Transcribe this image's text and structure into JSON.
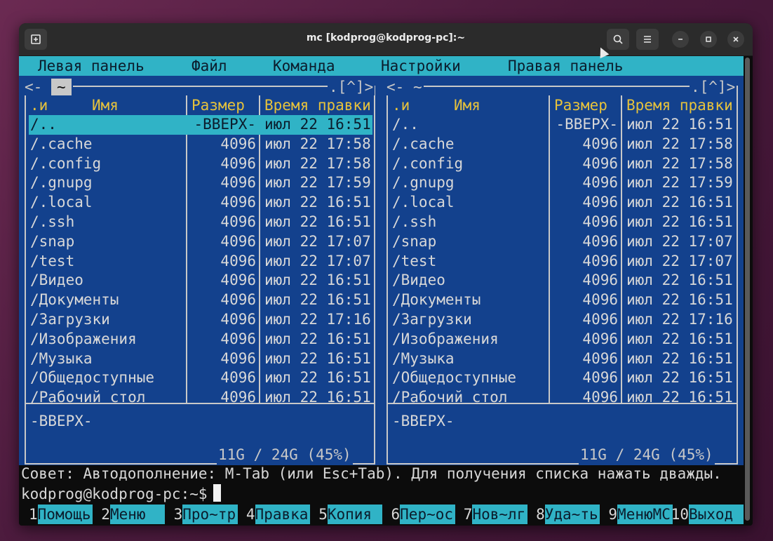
{
  "window": {
    "title": "mc [kodprog@kodprog-pc]:~"
  },
  "menubar": {
    "items": [
      "Левая панель",
      "Файл",
      "Команда",
      "Настройки",
      "Правая панель"
    ]
  },
  "left_panel": {
    "path": "~",
    "top_right": ".[^]>",
    "top_left": "<-",
    "headers": {
      "n": ".и",
      "name": "Имя",
      "size": "Размер",
      "mtime": "Время правки"
    },
    "rows": [
      {
        "name": "/..",
        "size": "-ВВЕРХ-",
        "mtime": "июл 22 16:51"
      },
      {
        "name": "/.cache",
        "size": "4096",
        "mtime": "июл 22 17:58"
      },
      {
        "name": "/.config",
        "size": "4096",
        "mtime": "июл 22 17:58"
      },
      {
        "name": "/.gnupg",
        "size": "4096",
        "mtime": "июл 22 17:59"
      },
      {
        "name": "/.local",
        "size": "4096",
        "mtime": "июл 22 16:51"
      },
      {
        "name": "/.ssh",
        "size": "4096",
        "mtime": "июл 22 16:51"
      },
      {
        "name": "/snap",
        "size": "4096",
        "mtime": "июл 22 17:07"
      },
      {
        "name": "/test",
        "size": "4096",
        "mtime": "июл 22 17:07"
      },
      {
        "name": "/Видео",
        "size": "4096",
        "mtime": "июл 22 16:51"
      },
      {
        "name": "/Документы",
        "size": "4096",
        "mtime": "июл 22 16:51"
      },
      {
        "name": "/Загрузки",
        "size": "4096",
        "mtime": "июл 22 17:16"
      },
      {
        "name": "/Изображения",
        "size": "4096",
        "mtime": "июл 22 16:51"
      },
      {
        "name": "/Музыка",
        "size": "4096",
        "mtime": "июл 22 16:51"
      },
      {
        "name": "/Общедоступные",
        "size": "4096",
        "mtime": "июл 22 16:51"
      },
      {
        "name": "/Рабочий стол",
        "size": "4096",
        "mtime": "июл 22 16:51"
      }
    ],
    "status": "-ВВЕРХ-",
    "disk": "11G / 24G (45%)"
  },
  "right_panel": {
    "path": "~",
    "top_right": ".[^]>",
    "top_left": "<-",
    "headers": {
      "n": ".и",
      "name": "Имя",
      "size": "Размер",
      "mtime": "Время правки"
    },
    "rows": [
      {
        "name": "/..",
        "size": "-ВВЕРХ-",
        "mtime": "июл 22 16:51"
      },
      {
        "name": "/.cache",
        "size": "4096",
        "mtime": "июл 22 17:58"
      },
      {
        "name": "/.config",
        "size": "4096",
        "mtime": "июл 22 17:58"
      },
      {
        "name": "/.gnupg",
        "size": "4096",
        "mtime": "июл 22 17:59"
      },
      {
        "name": "/.local",
        "size": "4096",
        "mtime": "июл 22 16:51"
      },
      {
        "name": "/.ssh",
        "size": "4096",
        "mtime": "июл 22 16:51"
      },
      {
        "name": "/snap",
        "size": "4096",
        "mtime": "июл 22 17:07"
      },
      {
        "name": "/test",
        "size": "4096",
        "mtime": "июл 22 17:07"
      },
      {
        "name": "/Видео",
        "size": "4096",
        "mtime": "июл 22 16:51"
      },
      {
        "name": "/Документы",
        "size": "4096",
        "mtime": "июл 22 16:51"
      },
      {
        "name": "/Загрузки",
        "size": "4096",
        "mtime": "июл 22 17:16"
      },
      {
        "name": "/Изображения",
        "size": "4096",
        "mtime": "июл 22 16:51"
      },
      {
        "name": "/Музыка",
        "size": "4096",
        "mtime": "июл 22 16:51"
      },
      {
        "name": "/Общедоступные",
        "size": "4096",
        "mtime": "июл 22 16:51"
      },
      {
        "name": "/Рабочий стол",
        "size": "4096",
        "mtime": "июл 22 16:51"
      }
    ],
    "status": "-ВВЕРХ-",
    "disk": "11G / 24G (45%)"
  },
  "hint": "Совет: Автодополнение: M-Tab (или Esc+Tab). Для получения списка нажать дважды.",
  "prompt": "kodprog@kodprog-pc:~$",
  "fkeys": [
    {
      "num": "1",
      "label": "Помощь"
    },
    {
      "num": "2",
      "label": "Меню  "
    },
    {
      "num": "3",
      "label": "Про~тр"
    },
    {
      "num": "4",
      "label": "Правка"
    },
    {
      "num": "5",
      "label": "Копия "
    },
    {
      "num": "6",
      "label": "Пер~ос"
    },
    {
      "num": "7",
      "label": "Нов~лг"
    },
    {
      "num": "8",
      "label": "Уда~ть"
    },
    {
      "num": "9",
      "label": "МенюMC"
    },
    {
      "num": "10",
      "label": "Выход "
    }
  ],
  "colors": {
    "panel_bg": "#13418d",
    "accent_cyan": "#30b3c6",
    "header_yellow": "#e6c23c"
  },
  "icons": {
    "new_tab": "new-tab-icon",
    "search": "search-icon",
    "menu": "hamburger-menu-icon",
    "minimize": "minimize-icon",
    "maximize": "maximize-icon",
    "close": "close-icon"
  }
}
